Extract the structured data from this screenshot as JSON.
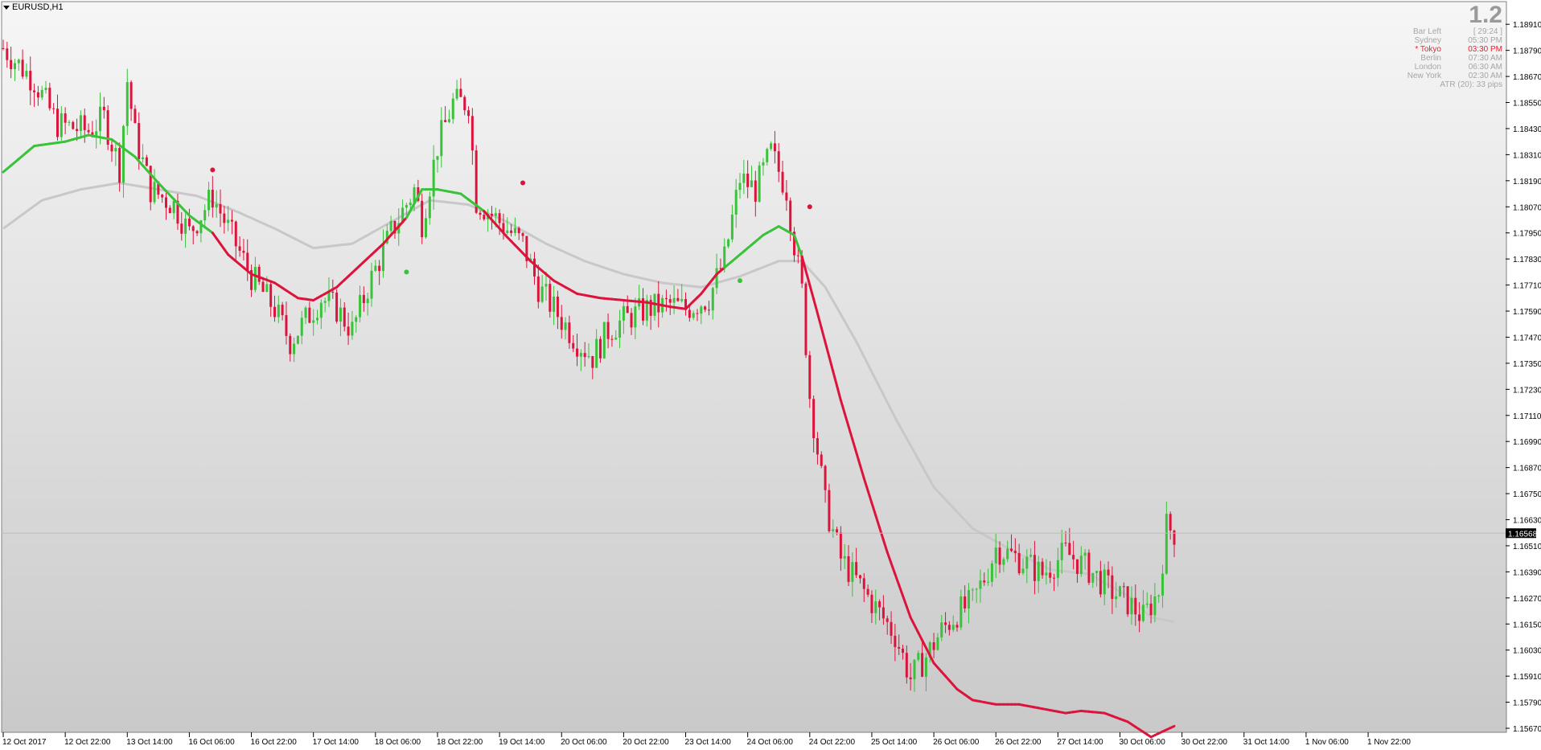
{
  "window": {
    "title": "EURUSD,H1"
  },
  "info_panel": {
    "big_value": "1.2",
    "rows": [
      {
        "label": "Bar Left",
        "value": "[ 29:24 ]",
        "highlight": false
      },
      {
        "label": "Sydney",
        "value": "05:30 PM",
        "highlight": false
      },
      {
        "label": "* Tokyo",
        "value": "03:30 PM",
        "highlight": true
      },
      {
        "label": "Berlin",
        "value": "07:30 AM",
        "highlight": false
      },
      {
        "label": "London",
        "value": "06:30 AM",
        "highlight": false
      },
      {
        "label": "New York",
        "value": "02:30 AM",
        "highlight": false
      }
    ],
    "atr": "ATR (20): 33 pips"
  },
  "colors": {
    "bull": "#39c23a",
    "bear": "#dc143c",
    "slow_ma": "#c8c8c8",
    "axis_text": "#000000",
    "current_price_bg": "#000000",
    "current_price_text": "#ffffff"
  },
  "chart_data": {
    "type": "candlestick",
    "symbol": "EURUSD",
    "timeframe": "H1",
    "ylim": [
      1.1567,
      1.1897
    ],
    "y_ticks": [
      "1.18910",
      "1.18790",
      "1.18670",
      "1.18550",
      "1.18430",
      "1.18310",
      "1.18190",
      "1.18070",
      "1.17950",
      "1.17830",
      "1.17710",
      "1.17590",
      "1.17470",
      "1.17350",
      "1.17230",
      "1.17110",
      "1.16990",
      "1.16870",
      "1.16750",
      "1.16630",
      "1.16510",
      "1.16390",
      "1.16270",
      "1.16150",
      "1.16030",
      "1.15910",
      "1.15790",
      "1.15670"
    ],
    "x_ticks": [
      "12 Oct 2017",
      "12 Oct 22:00",
      "13 Oct 14:00",
      "16 Oct 06:00",
      "16 Oct 22:00",
      "17 Oct 14:00",
      "18 Oct 06:00",
      "18 Oct 22:00",
      "19 Oct 14:00",
      "20 Oct 06:00",
      "20 Oct 22:00",
      "23 Oct 14:00",
      "24 Oct 06:00",
      "24 Oct 22:00",
      "25 Oct 14:00",
      "26 Oct 06:00",
      "26 Oct 22:00",
      "27 Oct 14:00",
      "30 Oct 06:00",
      "30 Oct 22:00",
      "31 Oct 14:00",
      "1 Nov 06:00",
      "1 Nov 22:00"
    ],
    "current_price": "1.16568",
    "price_path": [
      [
        0,
        1.188
      ],
      [
        8,
        1.1865
      ],
      [
        14,
        1.1845
      ],
      [
        22,
        1.1842
      ],
      [
        26,
        1.1848
      ],
      [
        30,
        1.1825
      ],
      [
        32,
        1.1865
      ],
      [
        34,
        1.184
      ],
      [
        38,
        1.1815
      ],
      [
        44,
        1.1808
      ],
      [
        48,
        1.1795
      ],
      [
        54,
        1.1812
      ],
      [
        58,
        1.1797
      ],
      [
        64,
        1.1775
      ],
      [
        70,
        1.176
      ],
      [
        74,
        1.1745
      ],
      [
        82,
        1.1765
      ],
      [
        86,
        1.176
      ],
      [
        90,
        1.175
      ],
      [
        94,
        1.177
      ],
      [
        100,
        1.1795
      ],
      [
        106,
        1.1815
      ],
      [
        108,
        1.18
      ],
      [
        112,
        1.1835
      ],
      [
        116,
        1.1855
      ],
      [
        120,
        1.1855
      ],
      [
        122,
        1.181
      ],
      [
        128,
        1.18
      ],
      [
        134,
        1.179
      ],
      [
        138,
        1.177
      ],
      [
        142,
        1.176
      ],
      [
        148,
        1.1745
      ],
      [
        152,
        1.1738
      ],
      [
        156,
        1.175
      ],
      [
        160,
        1.1755
      ],
      [
        166,
        1.176
      ],
      [
        172,
        1.1762
      ],
      [
        176,
        1.176
      ],
      [
        182,
        1.1765
      ],
      [
        186,
        1.1783
      ],
      [
        190,
        1.182
      ],
      [
        194,
        1.1815
      ],
      [
        198,
        1.1832
      ],
      [
        202,
        1.1815
      ],
      [
        204,
        1.179
      ],
      [
        206,
        1.1768
      ],
      [
        208,
        1.172
      ],
      [
        212,
        1.167
      ],
      [
        216,
        1.1645
      ],
      [
        222,
        1.163
      ],
      [
        226,
        1.162
      ],
      [
        230,
        1.161
      ],
      [
        234,
        1.159
      ],
      [
        238,
        1.16
      ],
      [
        242,
        1.1612
      ],
      [
        246,
        1.162
      ],
      [
        250,
        1.1625
      ],
      [
        254,
        1.164
      ],
      [
        256,
        1.165
      ],
      [
        262,
        1.1645
      ],
      [
        268,
        1.1638
      ],
      [
        274,
        1.1648
      ],
      [
        280,
        1.164
      ],
      [
        286,
        1.163
      ],
      [
        290,
        1.1625
      ],
      [
        294,
        1.1618
      ],
      [
        298,
        1.163
      ],
      [
        300,
        1.166
      ],
      [
        302,
        1.1657
      ]
    ],
    "fast_ma": [
      [
        0,
        1.1823
      ],
      [
        8,
        1.1835
      ],
      [
        16,
        1.1837
      ],
      [
        22,
        1.184
      ],
      [
        28,
        1.1838
      ],
      [
        34,
        1.183
      ],
      [
        40,
        1.1818
      ],
      [
        48,
        1.1803
      ],
      [
        54,
        1.1795
      ],
      [
        58,
        1.1785
      ],
      [
        64,
        1.1776
      ],
      [
        70,
        1.1772
      ],
      [
        76,
        1.1765
      ],
      [
        80,
        1.1764
      ],
      [
        86,
        1.177
      ],
      [
        92,
        1.178
      ],
      [
        98,
        1.179
      ],
      [
        104,
        1.1802
      ],
      [
        108,
        1.1815
      ],
      [
        112,
        1.1815
      ],
      [
        118,
        1.1813
      ],
      [
        124,
        1.1805
      ],
      [
        130,
        1.1793
      ],
      [
        136,
        1.1782
      ],
      [
        142,
        1.1773
      ],
      [
        148,
        1.1767
      ],
      [
        154,
        1.1765
      ],
      [
        160,
        1.1764
      ],
      [
        166,
        1.1763
      ],
      [
        172,
        1.1761
      ],
      [
        176,
        1.176
      ],
      [
        180,
        1.1767
      ],
      [
        184,
        1.1776
      ],
      [
        190,
        1.1785
      ],
      [
        196,
        1.1794
      ],
      [
        200,
        1.1798
      ],
      [
        204,
        1.1794
      ],
      [
        206,
        1.1784
      ],
      [
        210,
        1.1758
      ],
      [
        216,
        1.1718
      ],
      [
        222,
        1.1682
      ],
      [
        228,
        1.1648
      ],
      [
        234,
        1.1618
      ],
      [
        240,
        1.1597
      ],
      [
        246,
        1.1585
      ],
      [
        250,
        1.158
      ],
      [
        256,
        1.1578
      ],
      [
        262,
        1.1578
      ],
      [
        268,
        1.1576
      ],
      [
        274,
        1.1574
      ],
      [
        278,
        1.1575
      ],
      [
        284,
        1.1574
      ],
      [
        290,
        1.157
      ],
      [
        296,
        1.1563
      ],
      [
        302,
        1.1568
      ]
    ],
    "fast_ma_bullish_ranges": [
      [
        0,
        54
      ],
      [
        104,
        124
      ],
      [
        186,
        206
      ]
    ],
    "slow_ma": [
      [
        0,
        1.1797
      ],
      [
        10,
        1.181
      ],
      [
        20,
        1.1815
      ],
      [
        30,
        1.1818
      ],
      [
        40,
        1.1815
      ],
      [
        50,
        1.1812
      ],
      [
        60,
        1.1805
      ],
      [
        70,
        1.1797
      ],
      [
        80,
        1.1788
      ],
      [
        90,
        1.179
      ],
      [
        100,
        1.18
      ],
      [
        110,
        1.181
      ],
      [
        120,
        1.1808
      ],
      [
        130,
        1.18
      ],
      [
        140,
        1.179
      ],
      [
        150,
        1.1782
      ],
      [
        160,
        1.1776
      ],
      [
        170,
        1.1772
      ],
      [
        180,
        1.177
      ],
      [
        190,
        1.1775
      ],
      [
        200,
        1.1782
      ],
      [
        206,
        1.1782
      ],
      [
        212,
        1.177
      ],
      [
        220,
        1.1745
      ],
      [
        230,
        1.171
      ],
      [
        240,
        1.1678
      ],
      [
        250,
        1.1659
      ],
      [
        260,
        1.1649
      ],
      [
        270,
        1.164
      ],
      [
        280,
        1.1638
      ],
      [
        290,
        1.1628
      ],
      [
        296,
        1.1618
      ],
      [
        302,
        1.1616
      ]
    ],
    "signal_dots": [
      {
        "index": 54,
        "price": 1.1824,
        "direction": "sell"
      },
      {
        "index": 104,
        "price": 1.1777,
        "direction": "buy"
      },
      {
        "index": 134,
        "price": 1.1818,
        "direction": "sell"
      },
      {
        "index": 190,
        "price": 1.1773,
        "direction": "buy"
      },
      {
        "index": 208,
        "price": 1.1807,
        "direction": "sell"
      }
    ],
    "bar_count": 303,
    "grid": false,
    "legend": "none"
  }
}
